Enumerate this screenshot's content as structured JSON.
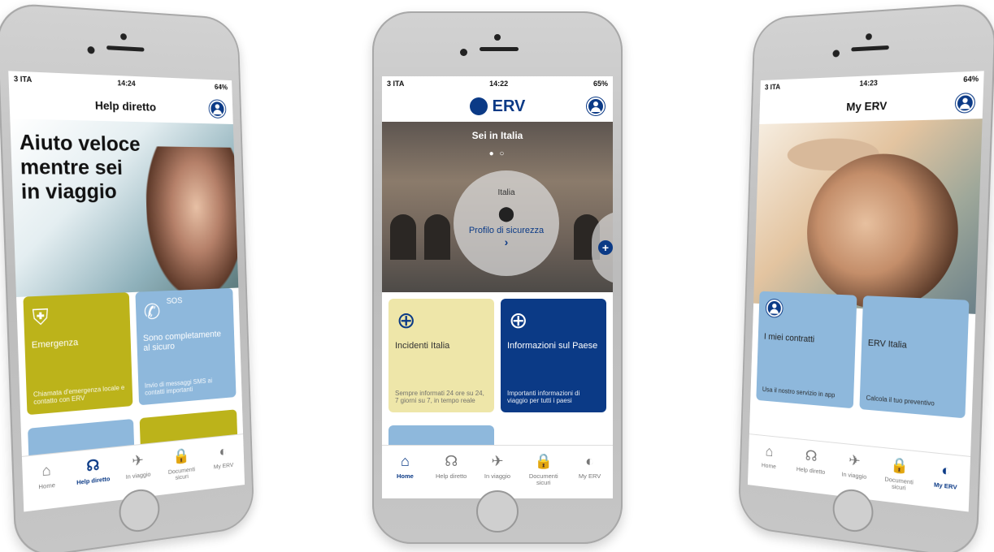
{
  "colors": {
    "brand_navy": "#0b3a86",
    "olive": "#bcb31a",
    "sky": "#8eb8dc",
    "cream": "#eee6a9"
  },
  "left": {
    "status": {
      "carrier": "3 ITA",
      "time": "14:24",
      "battery": "64%"
    },
    "title": "Help diretto",
    "hero": "Aiuto veloce mentre sei in viaggio",
    "tiles": [
      {
        "icon": "emergency-hand-icon",
        "title": "Emergenza",
        "sub": "Chiamata d'emergenza locale e contatto con ERV"
      },
      {
        "icon": "sos-phone-icon",
        "badge": "SOS",
        "title": "Sono completamente al sicuro",
        "sub": "Invio di messaggi SMS ai contatti importanti"
      }
    ],
    "tabs": [
      {
        "icon": "home-icon",
        "label": "Home"
      },
      {
        "icon": "headset-icon",
        "label": "Help diretto",
        "active": true
      },
      {
        "icon": "plane-icon",
        "label": "In viaggio"
      },
      {
        "icon": "lock-icon",
        "label": "Documenti sicuri"
      },
      {
        "icon": "erv-icon",
        "label": "My ERV"
      }
    ]
  },
  "middle": {
    "status": {
      "carrier": "3 ITA",
      "time": "14:22",
      "battery": "65%"
    },
    "logo": "ERV",
    "hero": {
      "caption": "Sei in Italia",
      "country": "Italia",
      "link": "Profilo di sicurezza"
    },
    "tiles": [
      {
        "icon": "globe-alert-icon",
        "title": "Incidenti Italia",
        "sub": "Sempre informati 24 ore su 24, 7 giorni su 7, in tempo reale"
      },
      {
        "icon": "globe-info-icon",
        "title": "Informazioni sul Paese",
        "sub": "Importanti informazioni di viaggio per tutti i paesi"
      }
    ],
    "tabs": [
      {
        "icon": "home-icon",
        "label": "Home",
        "active": true
      },
      {
        "icon": "headset-icon",
        "label": "Help diretto"
      },
      {
        "icon": "plane-icon",
        "label": "In viaggio"
      },
      {
        "icon": "lock-icon",
        "label": "Documenti sicuri"
      },
      {
        "icon": "erv-icon",
        "label": "My ERV"
      }
    ]
  },
  "right": {
    "status": {
      "carrier": "3 ITA",
      "time": "14:23",
      "battery": "64%"
    },
    "title": "My ERV",
    "tiles": [
      {
        "icon": "user-icon",
        "title": "I miei contratti",
        "sub": "Usa il nostro servizio in app"
      },
      {
        "icon": "",
        "title": "ERV Italia",
        "sub": "Calcola il tuo preventivo"
      }
    ],
    "tabs": [
      {
        "icon": "home-icon",
        "label": "Home"
      },
      {
        "icon": "headset-icon",
        "label": "Help diretto"
      },
      {
        "icon": "plane-icon",
        "label": "In viaggio"
      },
      {
        "icon": "lock-icon",
        "label": "Documenti sicuri"
      },
      {
        "icon": "erv-icon",
        "label": "My ERV",
        "active": true
      }
    ]
  }
}
